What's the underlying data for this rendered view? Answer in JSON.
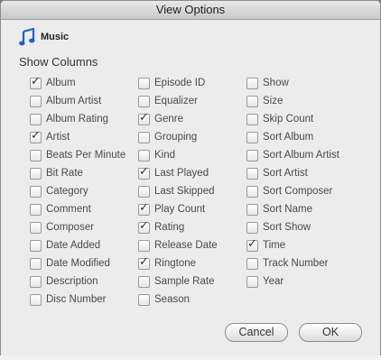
{
  "window": {
    "title": "View Options"
  },
  "source": {
    "label": "Music",
    "icon": "music-note-icon"
  },
  "section": {
    "label": "Show Columns"
  },
  "columns": [
    [
      {
        "label": "Album",
        "checked": true
      },
      {
        "label": "Album Artist",
        "checked": false
      },
      {
        "label": "Album Rating",
        "checked": false
      },
      {
        "label": "Artist",
        "checked": true
      },
      {
        "label": "Beats Per Minute",
        "checked": false
      },
      {
        "label": "Bit Rate",
        "checked": false
      },
      {
        "label": "Category",
        "checked": false
      },
      {
        "label": "Comment",
        "checked": false
      },
      {
        "label": "Composer",
        "checked": false
      },
      {
        "label": "Date Added",
        "checked": false
      },
      {
        "label": "Date Modified",
        "checked": false
      },
      {
        "label": "Description",
        "checked": false
      },
      {
        "label": "Disc Number",
        "checked": false
      }
    ],
    [
      {
        "label": "Episode ID",
        "checked": false
      },
      {
        "label": "Equalizer",
        "checked": false
      },
      {
        "label": "Genre",
        "checked": true
      },
      {
        "label": "Grouping",
        "checked": false
      },
      {
        "label": "Kind",
        "checked": false
      },
      {
        "label": "Last Played",
        "checked": true
      },
      {
        "label": "Last Skipped",
        "checked": false
      },
      {
        "label": "Play Count",
        "checked": true
      },
      {
        "label": "Rating",
        "checked": true
      },
      {
        "label": "Release Date",
        "checked": false
      },
      {
        "label": "Ringtone",
        "checked": true
      },
      {
        "label": "Sample Rate",
        "checked": false
      },
      {
        "label": "Season",
        "checked": false
      }
    ],
    [
      {
        "label": "Show",
        "checked": false
      },
      {
        "label": "Size",
        "checked": false
      },
      {
        "label": "Skip Count",
        "checked": false
      },
      {
        "label": "Sort Album",
        "checked": false
      },
      {
        "label": "Sort Album Artist",
        "checked": false
      },
      {
        "label": "Sort Artist",
        "checked": false
      },
      {
        "label": "Sort Composer",
        "checked": false
      },
      {
        "label": "Sort Name",
        "checked": false
      },
      {
        "label": "Sort Show",
        "checked": false
      },
      {
        "label": "Time",
        "checked": true
      },
      {
        "label": "Track Number",
        "checked": false
      },
      {
        "label": "Year",
        "checked": false
      }
    ]
  ],
  "buttons": {
    "cancel": "Cancel",
    "ok": "OK"
  }
}
